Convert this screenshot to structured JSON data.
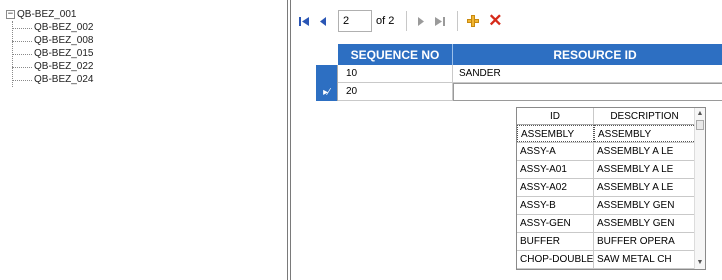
{
  "tree": {
    "root": "QB-BEZ_001",
    "expand_glyph": "−",
    "children": [
      "QB-BEZ_002",
      "QB-BEZ_008",
      "QB-BEZ_015",
      "QB-BEZ_022",
      "QB-BEZ_024"
    ]
  },
  "navigator": {
    "first_icon": "first-record-icon",
    "prev_icon": "previous-record-icon",
    "position_value": "2",
    "of_text": "of 2",
    "next_icon": "next-record-icon",
    "last_icon": "last-record-icon",
    "add_icon": "add-icon",
    "delete_icon": "delete-icon"
  },
  "grid": {
    "columns": [
      "SEQUENCE NO",
      "RESOURCE ID"
    ],
    "rows": [
      {
        "sequence_no": "10",
        "resource_id": "SANDER"
      },
      {
        "sequence_no": "20",
        "resource_id": ""
      }
    ],
    "editing_indicator": "▸∕"
  },
  "dropdown": {
    "columns": [
      "ID",
      "DESCRIPTION"
    ],
    "rows": [
      {
        "id": "ASSEMBLY",
        "description": "ASSEMBLY"
      },
      {
        "id": "ASSY-A",
        "description": "ASSEMBLY A LE"
      },
      {
        "id": "ASSY-A01",
        "description": "ASSEMBLY A LE"
      },
      {
        "id": "ASSY-A02",
        "description": "ASSEMBLY A LE"
      },
      {
        "id": "ASSY-B",
        "description": "ASSEMBLY GEN"
      },
      {
        "id": "ASSY-GEN",
        "description": "ASSEMBLY GEN"
      },
      {
        "id": "BUFFER",
        "description": "BUFFER OPERA"
      },
      {
        "id": "CHOP-DOUBLE",
        "description": "SAW METAL CH"
      }
    ]
  },
  "colors": {
    "header_blue": "#2d6fc2",
    "delete_red": "#d62a1a",
    "add_orange": "#f2b632"
  }
}
